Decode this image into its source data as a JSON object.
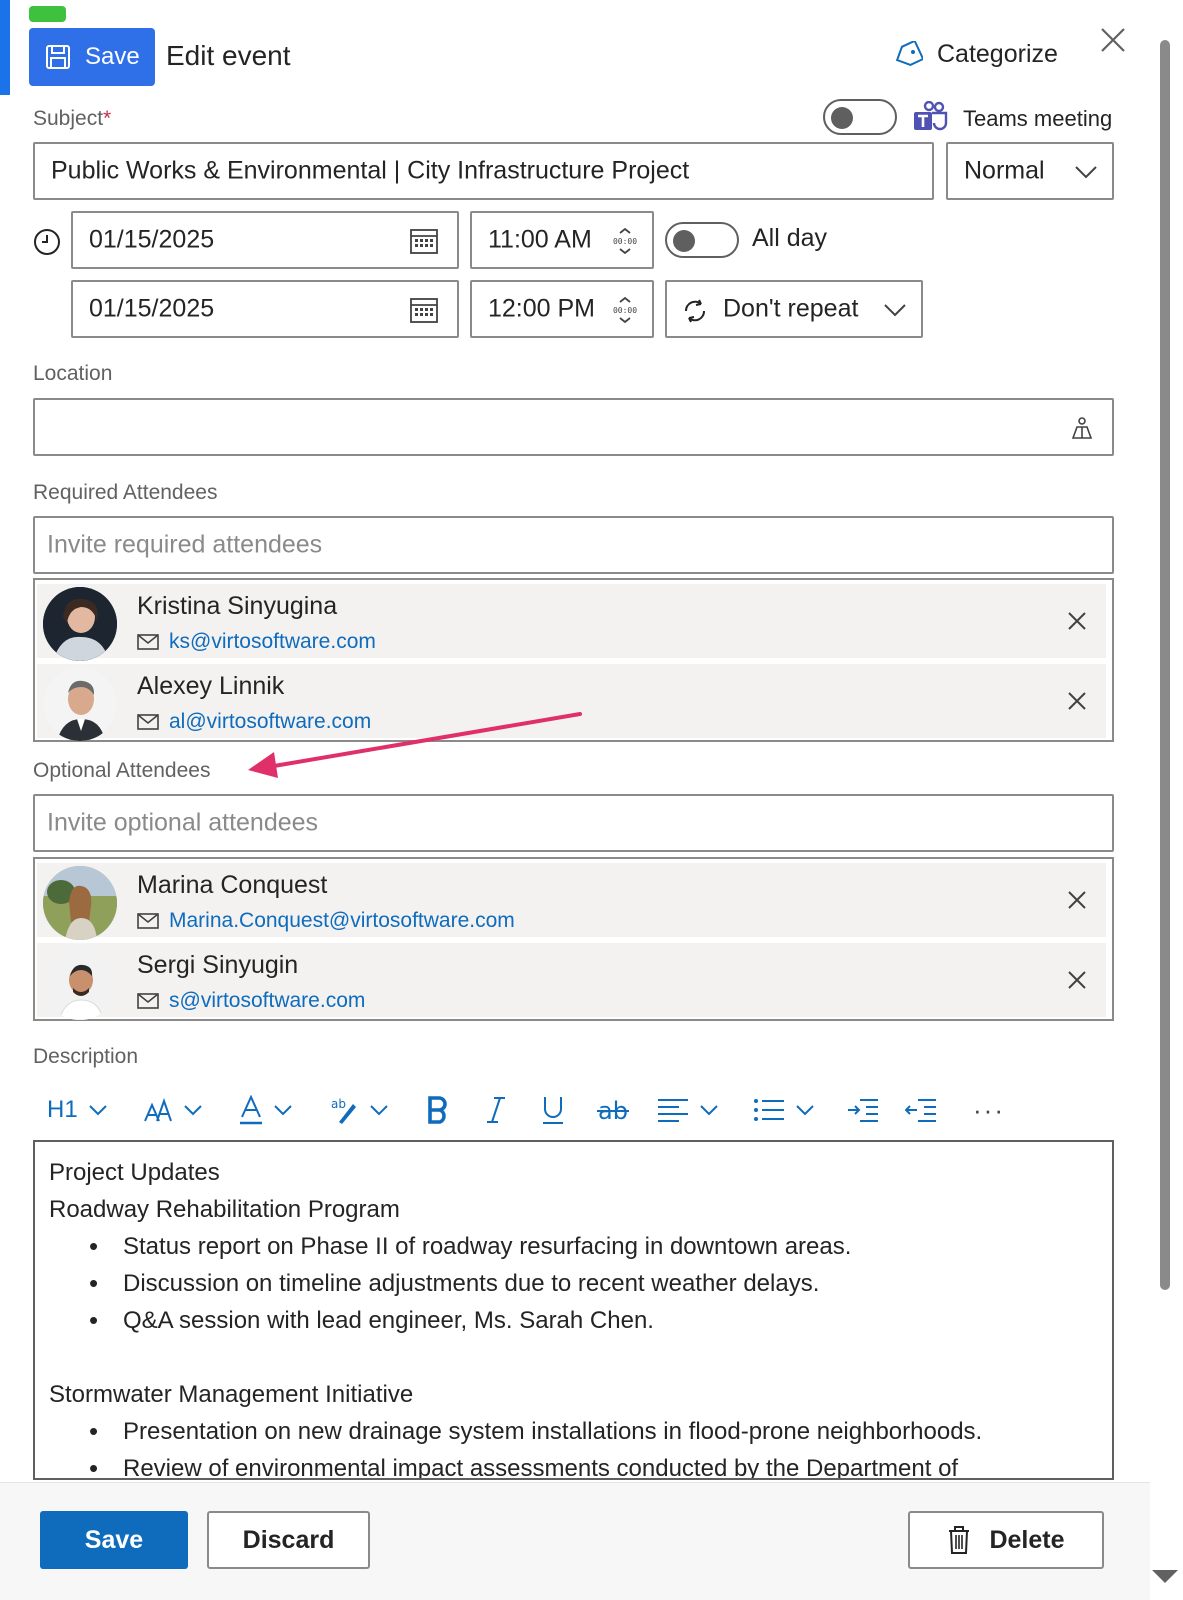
{
  "header": {
    "save_label": "Save",
    "title": "Edit event",
    "categorize_label": "Categorize"
  },
  "subject": {
    "label": "Subject",
    "required_mark": "*",
    "value": "Public Works & Environmental | City Infrastructure Project"
  },
  "teams": {
    "label": "Teams meeting",
    "enabled": false
  },
  "importance": {
    "value": "Normal"
  },
  "datetime": {
    "start_date": "01/15/2025",
    "start_time": "11:00 AM",
    "end_date": "01/15/2025",
    "end_time": "12:00 PM",
    "all_day_label": "All day",
    "all_day": false,
    "repeat_value": "Don't repeat"
  },
  "location": {
    "label": "Location",
    "value": ""
  },
  "required_attendees": {
    "label": "Required Attendees",
    "placeholder": "Invite required attendees",
    "people": [
      {
        "name": "Kristina Sinyugina",
        "email": "ks@virtosoftware.com"
      },
      {
        "name": "Alexey Linnik",
        "email": "al@virtosoftware.com"
      }
    ]
  },
  "optional_attendees": {
    "label": "Optional Attendees",
    "placeholder": "Invite optional attendees",
    "people": [
      {
        "name": "Marina Conquest",
        "email": "Marina.Conquest@virtosoftware.com"
      },
      {
        "name": "Sergi Sinyugin",
        "email": "s@virtosoftware.com"
      }
    ]
  },
  "description": {
    "label": "Description",
    "toolbar": {
      "heading_label": "H1",
      "more_label": "···"
    },
    "content": {
      "heading": "Project Updates",
      "section1_title": "Roadway Rehabilitation Program",
      "section1_items": [
        "Status report on Phase II of roadway resurfacing in downtown areas.",
        "Discussion on timeline adjustments due to recent weather delays.",
        "Q&A session with lead engineer, Ms. Sarah Chen."
      ],
      "section2_title": "Stormwater Management Initiative",
      "section2_items": [
        "Presentation on new drainage system installations in flood-prone neighborhoods.",
        "Review of environmental impact assessments conducted by the Department of"
      ]
    }
  },
  "footer": {
    "save_label": "Save",
    "discard_label": "Discard",
    "delete_label": "Delete"
  },
  "colors": {
    "accent": "#0f6cbd",
    "save_top": "#2f6fe8",
    "annotation_arrow": "#e0306a"
  }
}
